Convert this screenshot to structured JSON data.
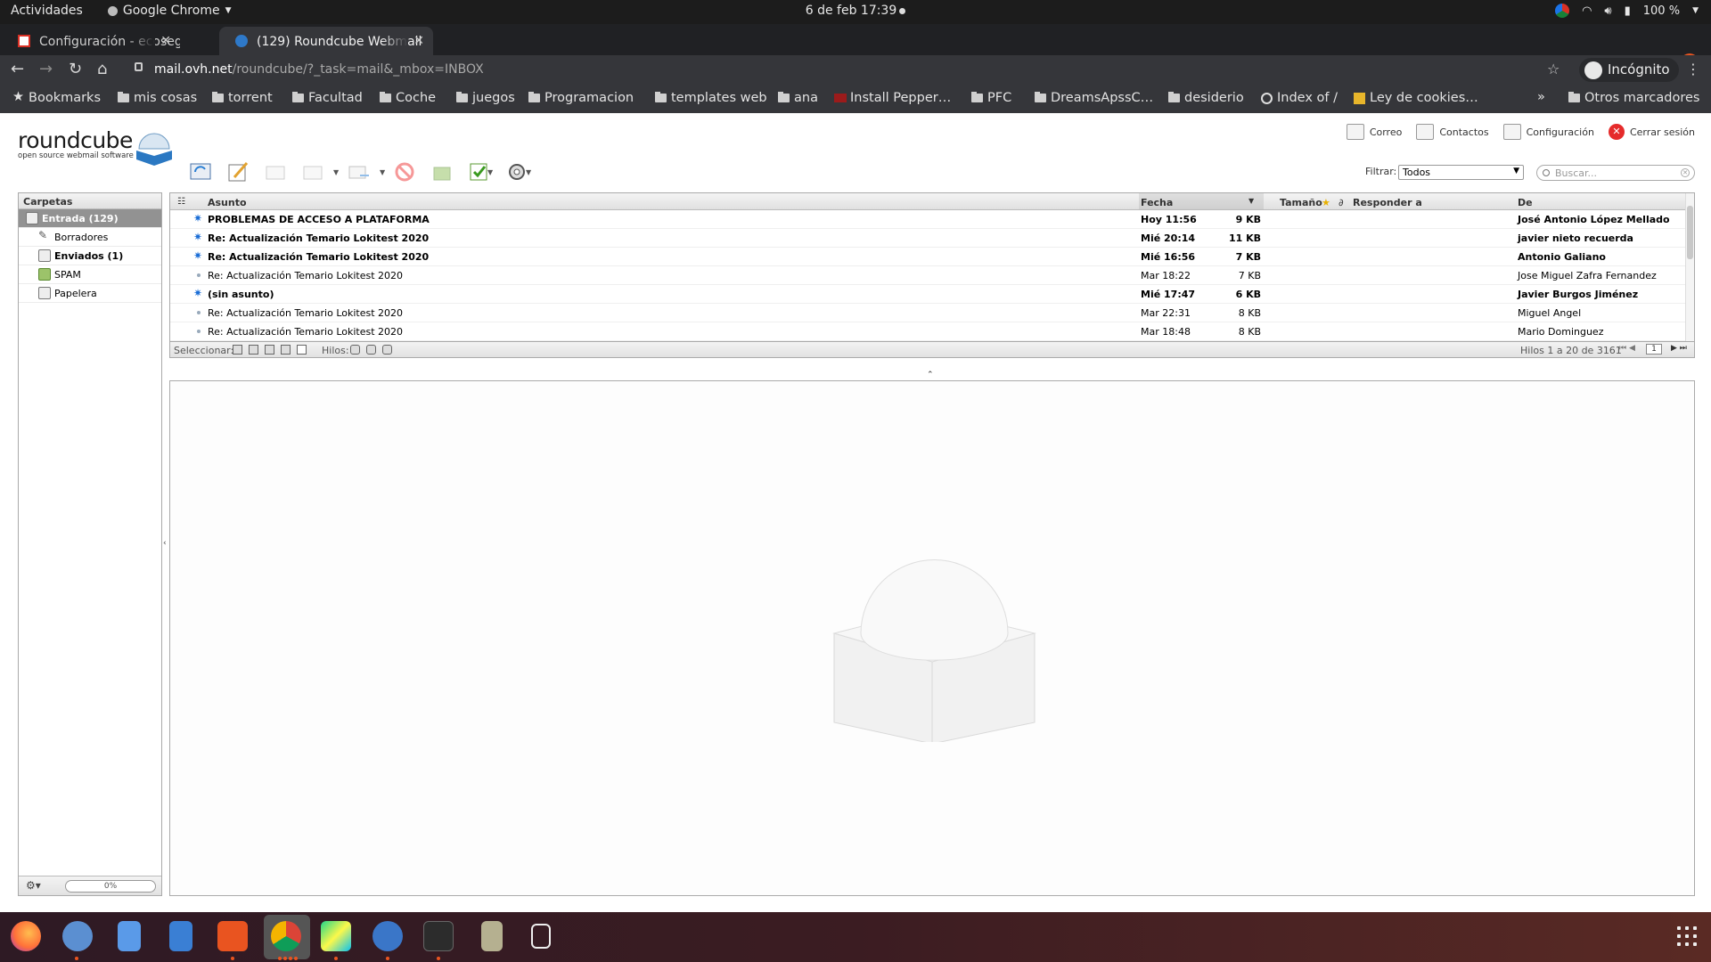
{
  "system": {
    "activities": "Actividades",
    "app_name": "Google Chrome",
    "clock": "6 de feb  17:39",
    "battery": "100 %"
  },
  "tabs": [
    {
      "title": "Configuración - ecoseguro",
      "active": false
    },
    {
      "title": "(129) Roundcube Webmail",
      "active": true
    }
  ],
  "address": {
    "host": "mail.ovh.net",
    "path": "/roundcube/?_task=mail&_mbox=INBOX"
  },
  "profile": {
    "label": "Incógnito"
  },
  "bookmarks": [
    {
      "label": "Bookmarks",
      "icon": "star-icon"
    },
    {
      "label": "mis cosas",
      "icon": "folder-icon"
    },
    {
      "label": "torrent",
      "icon": "folder-icon"
    },
    {
      "label": "Facultad",
      "icon": "folder-icon"
    },
    {
      "label": "Coche",
      "icon": "folder-icon"
    },
    {
      "label": "juegos",
      "icon": "folder-icon"
    },
    {
      "label": "Programacion",
      "icon": "folder-icon"
    },
    {
      "label": "templates web",
      "icon": "folder-icon"
    },
    {
      "label": "ana",
      "icon": "folder-icon"
    },
    {
      "label": "Install Pepper…",
      "icon": "site-icon"
    },
    {
      "label": "PFC",
      "icon": "folder-icon"
    },
    {
      "label": "DreamsApssC…",
      "icon": "folder-icon"
    },
    {
      "label": "desiderio",
      "icon": "folder-icon"
    },
    {
      "label": "Index of /",
      "icon": "globe-icon"
    },
    {
      "label": "Ley de cookies…",
      "icon": "site-icon"
    },
    {
      "label": "Otros marcadores",
      "icon": "folder-icon"
    }
  ],
  "logo": {
    "name": "roundcube",
    "tagline": "open source webmail software"
  },
  "topnav": [
    {
      "label": "Correo",
      "icon": "mail-icon"
    },
    {
      "label": "Contactos",
      "icon": "contacts-icon"
    },
    {
      "label": "Configuración",
      "icon": "settings-icon"
    },
    {
      "label": "Cerrar sesión",
      "icon": "logout-icon"
    }
  ],
  "filter": {
    "label": "Filtrar:",
    "value": "Todos"
  },
  "search": {
    "placeholder": "Buscar..."
  },
  "folders": {
    "header": "Carpetas",
    "items": [
      {
        "label": "Entrada (129)",
        "selected": true,
        "icon": "inbox-icon"
      },
      {
        "label": "Borradores",
        "selected": false,
        "icon": "drafts-icon"
      },
      {
        "label": "Enviados (1)",
        "selected": false,
        "icon": "sent-icon"
      },
      {
        "label": "SPAM",
        "selected": false,
        "icon": "spam-icon"
      },
      {
        "label": "Papelera",
        "selected": false,
        "icon": "trash-icon"
      }
    ],
    "quota": "0%"
  },
  "list": {
    "columns": {
      "subject": "Asunto",
      "date": "Fecha",
      "size": "Tamaño",
      "replyto": "Responder a",
      "from": "De"
    },
    "messages": [
      {
        "subject": "PROBLEMAS DE ACCESO A PLATAFORMA",
        "date": "Hoy 11:56",
        "size": "9 KB",
        "from": "José Antonio López Mellado",
        "unread": true
      },
      {
        "subject": "Re: Actualización Temario Lokitest 2020",
        "date": "Mié 20:14",
        "size": "11 KB",
        "from": "javier nieto recuerda",
        "unread": true
      },
      {
        "subject": "Re: Actualización Temario Lokitest 2020",
        "date": "Mié 16:56",
        "size": "7 KB",
        "from": "Antonio Galiano",
        "unread": true
      },
      {
        "subject": "Re: Actualización Temario Lokitest 2020",
        "date": "Mar 18:22",
        "size": "7 KB",
        "from": "Jose Miguel Zafra Fernandez",
        "unread": false
      },
      {
        "subject": "(sin asunto)",
        "date": "Mié 17:47",
        "size": "6 KB",
        "from": "Javier Burgos Jiménez",
        "unread": true
      },
      {
        "subject": "Re: Actualización Temario Lokitest 2020",
        "date": "Mar 22:31",
        "size": "8 KB",
        "from": "Miguel Angel",
        "unread": false
      },
      {
        "subject": "Re: Actualización Temario Lokitest 2020",
        "date": "Mar 18:48",
        "size": "8 KB",
        "from": "Mario Dominguez",
        "unread": false
      }
    ],
    "select_label": "Seleccionar:",
    "threads_label": "Hilos:",
    "count": "Hilos 1 a 20 de 3161",
    "page": "1"
  }
}
